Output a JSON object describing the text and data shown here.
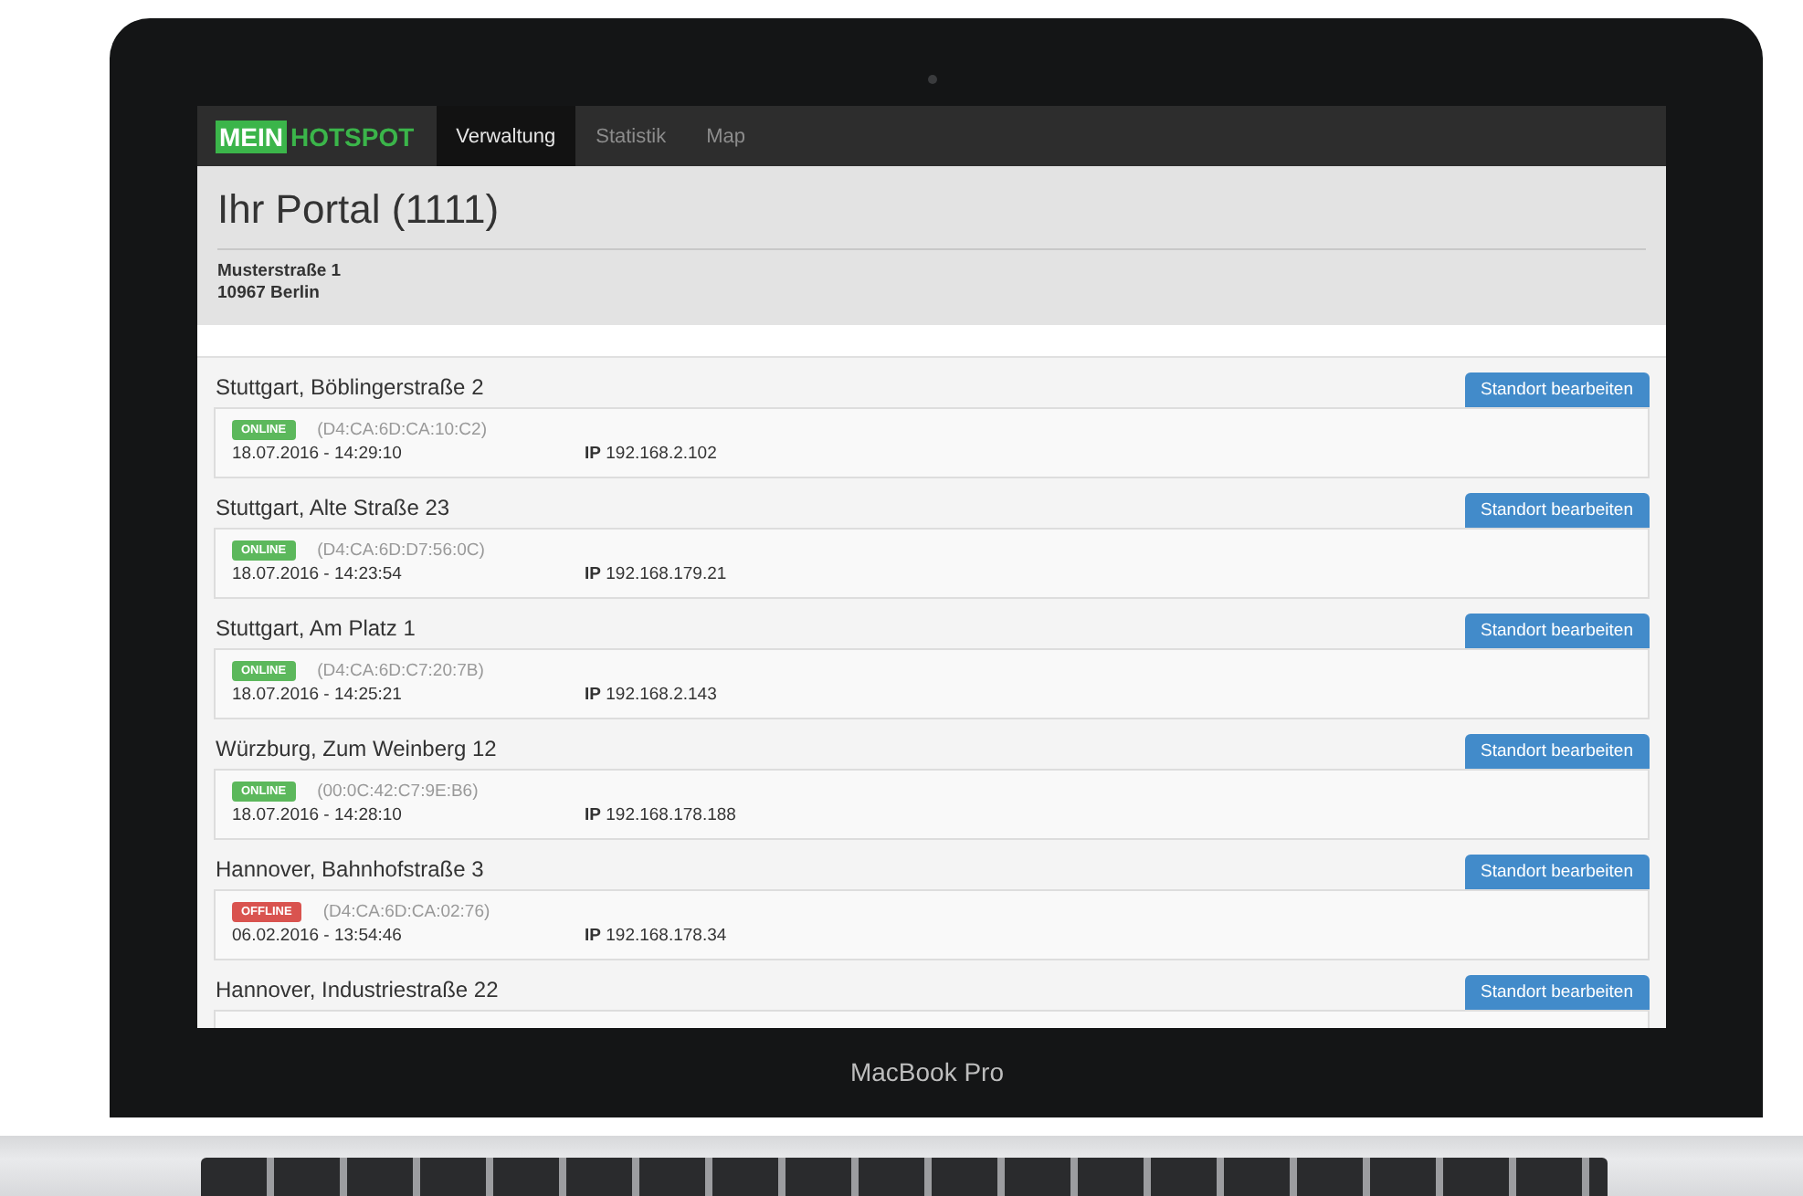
{
  "brand": {
    "part_1": "MEIN",
    "part_2": "HOTSPOT"
  },
  "tabs": [
    {
      "label": "Verwaltung",
      "selected": true
    },
    {
      "label": "Statistik",
      "selected": false
    },
    {
      "label": "Map",
      "selected": false
    }
  ],
  "portal": {
    "title": "Ihr Portal (1111)",
    "street": "Musterstraße 1",
    "city": "10967 Berlin"
  },
  "locations": [
    {
      "name": "Stuttgart, Böblingerstraße 2",
      "button": "Standort bearbeiten",
      "online": true,
      "status": "ONLINE",
      "mac": "(D4:CA:6D:CA:10:C2)",
      "time": "18.07.2016 - 14:29:10",
      "ip_label": "IP",
      "ip": "192.168.2.102"
    },
    {
      "name": "Stuttgart, Alte Straße 23",
      "button": "Standort bearbeiten",
      "online": true,
      "status": "ONLINE",
      "mac": "(D4:CA:6D:D7:56:0C)",
      "time": "18.07.2016 - 14:23:54",
      "ip_label": "IP",
      "ip": "192.168.179.21"
    },
    {
      "name": "Stuttgart, Am Platz 1",
      "button": "Standort bearbeiten",
      "online": true,
      "status": "ONLINE",
      "mac": "(D4:CA:6D:C7:20:7B)",
      "time": "18.07.2016 - 14:25:21",
      "ip_label": "IP",
      "ip": "192.168.2.143"
    },
    {
      "name": "Würzburg, Zum Weinberg 12",
      "button": "Standort bearbeiten",
      "online": true,
      "status": "ONLINE",
      "mac": "(00:0C:42:C7:9E:B6)",
      "time": "18.07.2016 - 14:28:10",
      "ip_label": "IP",
      "ip": "192.168.178.188"
    },
    {
      "name": "Hannover, Bahnhofstraße 3",
      "button": "Standort bearbeiten",
      "online": false,
      "status": "OFFLINE",
      "mac": "(D4:CA:6D:CA:02:76)",
      "time": "06.02.2016 - 13:54:46",
      "ip_label": "IP",
      "ip": "192.168.178.34"
    },
    {
      "name": "Hannover, Industriestraße 22",
      "button": "Standort bearbeiten"
    }
  ],
  "device_label": "MacBook Pro"
}
